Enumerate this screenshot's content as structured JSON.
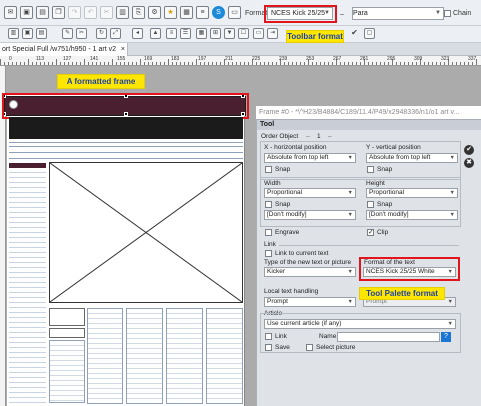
{
  "toolbar": {
    "format_label": "Format",
    "format_value": "NCES Kick 25/25",
    "para_label": "Para",
    "chain_label": "Chain",
    "icons": [
      "mail-icon",
      "image-icon",
      "save-icon",
      "copy-icon",
      "redo-icon",
      "undo-icon",
      "clipboard-icon",
      "paste-icon",
      "star-icon",
      "skype-icon",
      "page-icon"
    ]
  },
  "callouts": {
    "toolbar_format": "Toolbar format",
    "formatted_frame": "A formatted frame",
    "tool_palette_format": "Tool Palette format"
  },
  "tab": {
    "title": "ort Special Full /w751/h950 - 1 art v2",
    "close": "×"
  },
  "ruler": {
    "numbers": [
      "0",
      "113",
      "127",
      "141",
      "155",
      "169",
      "183",
      "197",
      "211",
      "225",
      "239",
      "253",
      "267",
      "281",
      "295",
      "309",
      "323",
      "337"
    ]
  },
  "frame_window": {
    "title": "Frame #0 - *\\^H23/B4884/C189/11.4/P49/x2948336/n1/o1 art v..."
  },
  "panel": {
    "header": "Tool",
    "order_object_label": "Order Object",
    "order_object_value": "1",
    "x_label": "X - horizontal position",
    "x_value": "Absolute from top left",
    "x_snap": "Snap",
    "y_label": "Y - vertical position",
    "y_value": "Absolute from top left",
    "y_snap": "Snap",
    "width_label": "Width",
    "width_value": "Proportional",
    "width_snap": "Snap",
    "width_modify": "[Don't modify]",
    "height_label": "Height",
    "height_value": "Proportional",
    "height_snap": "Snap",
    "height_modify": "[Don't modify]",
    "engrave_label": "Engrave",
    "clip_label": "Clip",
    "link_label": "Link",
    "link_to_current": "Link to current text",
    "type_new_label": "Type of the new text or picture",
    "type_new_value": "Kicker",
    "format_text_label": "Format of the text",
    "format_text_value": "NCES Kick 25/25 White",
    "local_text_label": "Local text handling",
    "local_text_value": "Prompt",
    "local_text_value2": "Prompt",
    "article_label": "Article",
    "article_value": "Use current article (if any)",
    "link_cb": "Link",
    "name_label": "Name",
    "save_cb": "Save",
    "select_picture": "Select picture",
    "help": "?"
  }
}
